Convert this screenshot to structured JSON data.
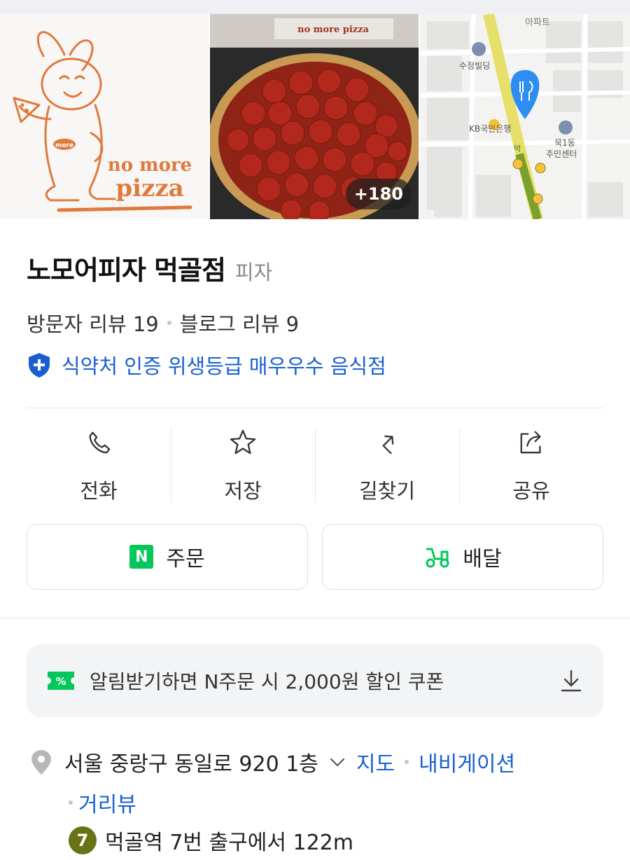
{
  "gallery": {
    "logo_text_top": "no more",
    "logo_text_bottom": "pizza",
    "logo_badge": "more",
    "box_text": "no more pizza",
    "photo_count": "+180",
    "map_labels": {
      "apt": "아파트",
      "building": "수정빌딩",
      "bank": "KB국민은행",
      "center_line1": "묵1동",
      "center_line2": "주민센터",
      "station_char": "먹"
    }
  },
  "store": {
    "name": "노모어피자 먹골점",
    "category": "피자",
    "visitor_reviews": "방문자 리뷰 19",
    "blog_reviews": "블로그 리뷰 9",
    "hygiene_badge": "식약처 인증 위생등급 매우우수 음식점"
  },
  "actions": [
    {
      "label": "전화",
      "icon": "phone-icon"
    },
    {
      "label": "저장",
      "icon": "star-icon"
    },
    {
      "label": "길찾기",
      "icon": "directions-icon"
    },
    {
      "label": "공유",
      "icon": "share-icon"
    }
  ],
  "order": {
    "n_badge": "N",
    "order_label": "주문",
    "delivery_label": "배달"
  },
  "coupon": {
    "tag": "%",
    "text": "알림받기하면 N주문 시 2,000원 할인 쿠폰"
  },
  "address": {
    "text": "서울 중랑구 동일로 920 1층",
    "map_link": "지도",
    "navi_link": "내비게이션",
    "street_link": "거리뷰"
  },
  "subway": {
    "line": "7",
    "text": "먹골역 7번 출구에서 122m"
  },
  "colors": {
    "link_blue": "#1a5fd1",
    "naver_green": "#03c75a",
    "line7_olive": "#697215",
    "logo_orange": "#e07a3c",
    "pepperoni": "#b2281c"
  }
}
